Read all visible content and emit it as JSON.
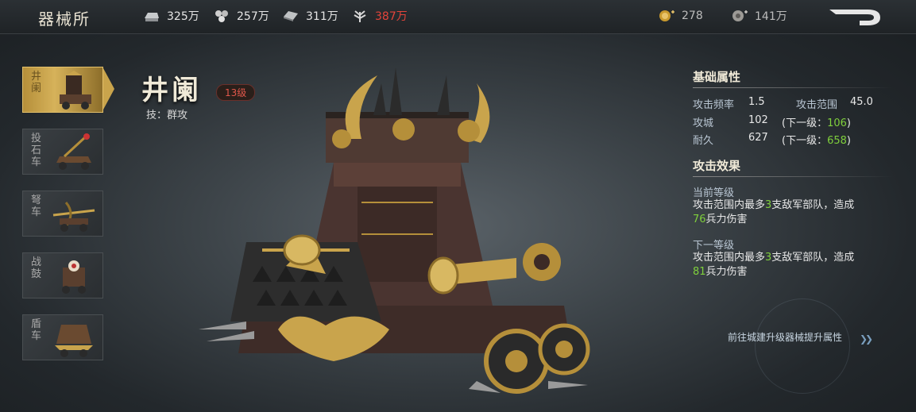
{
  "header": {
    "title": "器械所",
    "resources": [
      {
        "icon": "silver-ingot-icon",
        "value": "325万"
      },
      {
        "icon": "wood-icon",
        "value": "257万"
      },
      {
        "icon": "iron-icon",
        "value": "311万"
      },
      {
        "icon": "grain-icon",
        "value": "387万"
      }
    ],
    "gold": {
      "icon": "gold-coin-icon",
      "value": "278"
    },
    "copper": {
      "icon": "copper-coin-icon",
      "value": "141万"
    }
  },
  "tabs": [
    {
      "label": "井阑",
      "active": true
    },
    {
      "label": "投石车",
      "active": false
    },
    {
      "label": "弩车",
      "active": false
    },
    {
      "label": "战鼓",
      "active": false
    },
    {
      "label": "盾车",
      "active": false
    }
  ],
  "unit": {
    "name": "井阑",
    "level": "13级",
    "skill": "技：群攻"
  },
  "attributes": {
    "title": "基础属性",
    "attack_rate_label": "攻击频率",
    "attack_rate": "1.5",
    "attack_range_label": "攻击范围",
    "attack_range": "45.0",
    "siege_label": "攻城",
    "siege": "102",
    "siege_next_prefix": "(下一级：",
    "siege_next": "106",
    "durability_label": "耐久",
    "durability": "627",
    "durability_next_prefix": "(下一级：",
    "durability_next": "658",
    "close_paren": ")"
  },
  "effect": {
    "title": "攻击效果",
    "current_label": "当前等级",
    "current_pre": "攻击范围内最多",
    "current_count": "3",
    "current_mid": "支敌军部队，造成",
    "current_damage": "76",
    "current_post": "兵力伤害",
    "next_label": "下一等级",
    "next_pre": "攻击范围内最多",
    "next_count": "3",
    "next_mid": "支敌军部队，造成",
    "next_damage": "81",
    "next_post": "兵力伤害"
  },
  "goto_link": "前往城建升级器械提升属性",
  "colors": {
    "gold": "#c9a44c",
    "red": "#e3443a",
    "green": "#7fcf3c",
    "badge_red": "#e0574a"
  }
}
